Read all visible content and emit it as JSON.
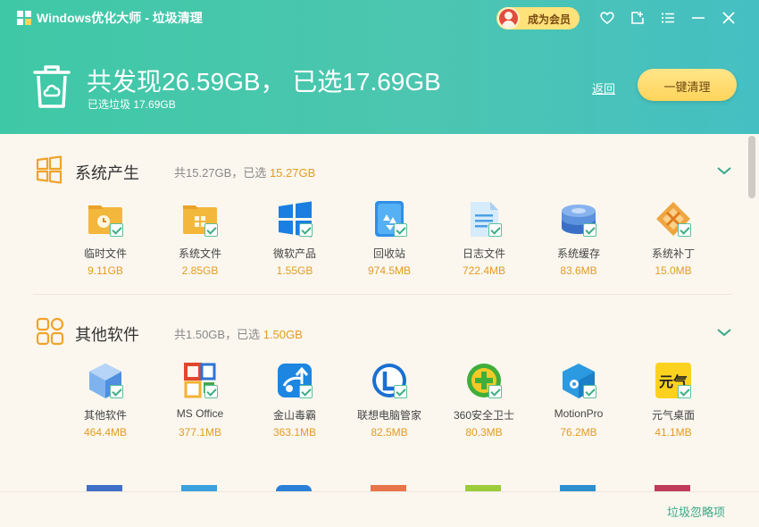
{
  "window": {
    "title": "Windows优化大师 - 垃圾清理",
    "vip_label": "成为会员"
  },
  "summary": {
    "headline": "共发现26.59GB， 已选17.69GB",
    "subline": "已选垃圾 17.69GB",
    "back_label": "返回",
    "clean_button_label": "一键清理"
  },
  "sections": [
    {
      "title": "系统产生",
      "stats_prefix": "共15.27GB，已选",
      "stats_selected": "15.27GB",
      "items": [
        {
          "name": "临时文件",
          "size": "9.11GB",
          "icon": "temp-folder-icon"
        },
        {
          "name": "系统文件",
          "size": "2.85GB",
          "icon": "system-folder-icon"
        },
        {
          "name": "微软产品",
          "size": "1.55GB",
          "icon": "windows-logo-icon"
        },
        {
          "name": "回收站",
          "size": "974.5MB",
          "icon": "recycle-bin-icon"
        },
        {
          "name": "日志文件",
          "size": "722.4MB",
          "icon": "log-file-icon"
        },
        {
          "name": "系统缓存",
          "size": "83.6MB",
          "icon": "cache-disk-icon"
        },
        {
          "name": "系统补丁",
          "size": "15.0MB",
          "icon": "patch-icon"
        }
      ]
    },
    {
      "title": "其他软件",
      "stats_prefix": "共1.50GB，已选",
      "stats_selected": "1.50GB",
      "items": [
        {
          "name": "其他软件",
          "size": "464.4MB",
          "icon": "software-cube-icon"
        },
        {
          "name": "MS Office",
          "size": "377.1MB",
          "icon": "ms-office-icon"
        },
        {
          "name": "金山毒霸",
          "size": "363.1MB",
          "icon": "kingsoft-antivirus-icon"
        },
        {
          "name": "联想电脑管家",
          "size": "82.5MB",
          "icon": "lenovo-manager-icon"
        },
        {
          "name": "360安全卫士",
          "size": "80.3MB",
          "icon": "360-safe-icon"
        },
        {
          "name": "MotionPro",
          "size": "76.2MB",
          "icon": "motionpro-icon"
        },
        {
          "name": "元气桌面",
          "size": "41.1MB",
          "icon": "yuanqi-desktop-icon"
        }
      ]
    }
  ],
  "footer": {
    "ignore_label": "垃圾忽略项"
  },
  "colors": {
    "header_start": "#3fc8a6",
    "header_end": "#45bfc2",
    "accent_orange": "#e39b23",
    "accent_green": "#3aa886",
    "clean_button": "#ffd45a"
  }
}
